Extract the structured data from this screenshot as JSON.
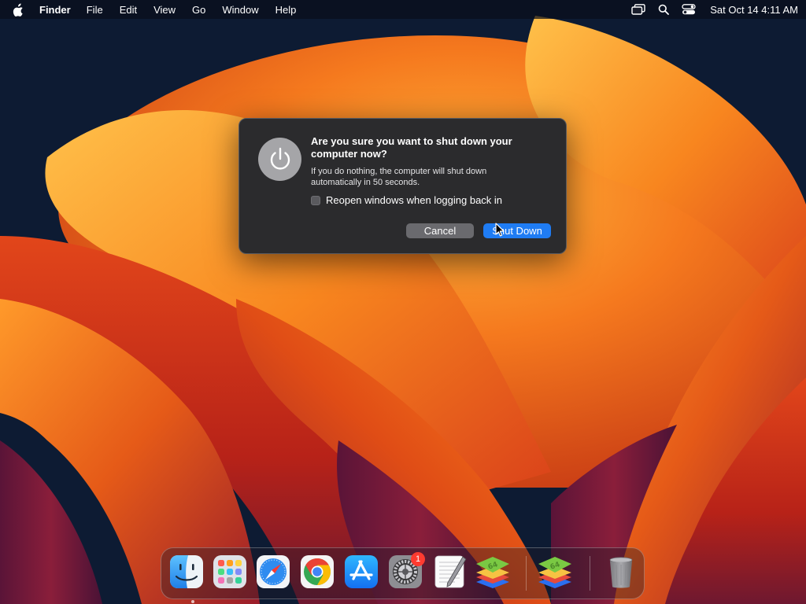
{
  "menubar": {
    "app_name": "Finder",
    "menus": [
      "File",
      "Edit",
      "View",
      "Go",
      "Window",
      "Help"
    ],
    "clock": "Sat Oct 14  4:11 AM",
    "status_icons": [
      "screen-mirroring-icon",
      "spotlight-search-icon",
      "control-center-icon"
    ]
  },
  "dialog": {
    "title": "Are you sure you want to shut down your computer now?",
    "message": "If you do nothing, the computer will shut down automatically in 50 seconds.",
    "checkbox_label": "Reopen windows when logging back in",
    "checkbox_checked": false,
    "cancel_label": "Cancel",
    "confirm_label": "Shut Down",
    "accent_color": "#1f7cf3"
  },
  "dock": {
    "apps": [
      {
        "name": "Finder",
        "icon": "finder-icon",
        "running": true
      },
      {
        "name": "Launchpad",
        "icon": "launchpad-icon"
      },
      {
        "name": "Safari",
        "icon": "safari-icon"
      },
      {
        "name": "Google Chrome",
        "icon": "chrome-icon"
      },
      {
        "name": "App Store",
        "icon": "app-store-icon"
      },
      {
        "name": "System Settings",
        "icon": "system-settings-icon",
        "badge": "1"
      },
      {
        "name": "TextEdit",
        "icon": "textedit-icon"
      },
      {
        "name": "BlueStacks",
        "icon": "bluestacks-icon"
      },
      {
        "name": "BlueStacks",
        "icon": "bluestacks-icon"
      },
      {
        "name": "Trash",
        "icon": "trash-icon"
      }
    ]
  }
}
